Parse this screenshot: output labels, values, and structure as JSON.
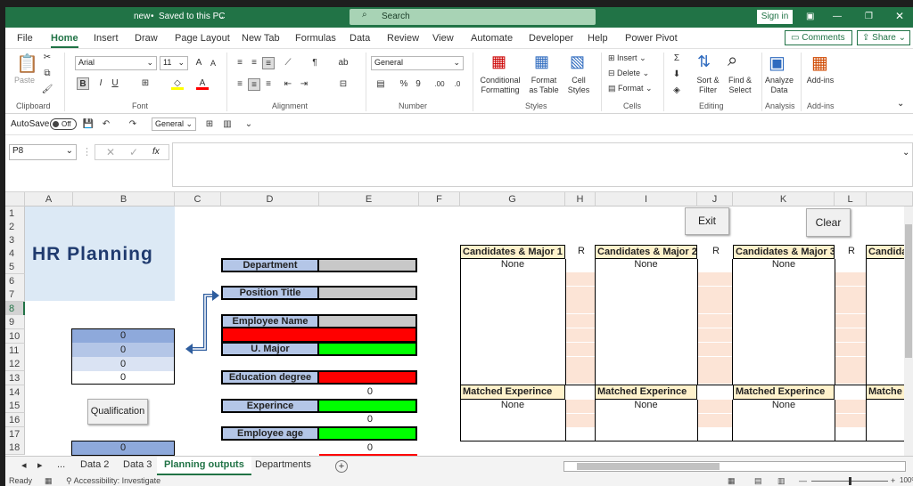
{
  "titlebar": {
    "doc": "new",
    "saved": "Saved to this PC",
    "search": "Search",
    "signin": "Sign in"
  },
  "menu": [
    "File",
    "Home",
    "Insert",
    "Draw",
    "Page Layout",
    "New Tab",
    "Formulas",
    "Data",
    "Review",
    "View",
    "Automate",
    "Developer",
    "Help",
    "Power Pivot"
  ],
  "menu_right": {
    "comments": "Comments",
    "share": "Share"
  },
  "ribbon": {
    "clipboard": "Clipboard",
    "paste": "Paste",
    "font_name": "Arial",
    "font_size": "11",
    "font": "Font",
    "alignment": "Alignment",
    "number_format": "General",
    "number": "Number",
    "conditional": "Conditional Formatting",
    "format_table": "Format as Table",
    "cell_styles": "Cell Styles",
    "styles": "Styles",
    "insert": "Insert",
    "delete": "Delete",
    "format": "Format",
    "cells": "Cells",
    "sort_filter": "Sort & Filter",
    "find_select": "Find & Select",
    "editing": "Editing",
    "analyze_data": "Analyze Data",
    "analysis": "Analysis",
    "addins": "Add-ins",
    "addins_grp": "Add-ins"
  },
  "qat": {
    "autosave": "AutoSave",
    "off": "Off",
    "style": "General"
  },
  "formula": {
    "namebox": "P8",
    "fx": "fx"
  },
  "columns": [
    "A",
    "B",
    "C",
    "D",
    "E",
    "F",
    "G",
    "H",
    "I",
    "J",
    "K",
    "L"
  ],
  "rows": [
    "1",
    "2",
    "3",
    "4",
    "5",
    "6",
    "7",
    "8",
    "9",
    "10",
    "11",
    "12",
    "13",
    "14",
    "15",
    "16",
    "17",
    "18"
  ],
  "sheet": {
    "title": "HR Planning",
    "labels": {
      "department": "Department",
      "position": "Position Title",
      "employee_name": "Employee Name",
      "u_major": "U. Major",
      "education": "Education degree",
      "experince": "Experince",
      "age": "Employee age"
    },
    "left_values": [
      "0",
      "0",
      "0",
      "0"
    ],
    "e_values": [
      "0",
      "0",
      "0"
    ],
    "b18": "0",
    "qualification": "Qualification",
    "exit": "Exit",
    "clear": "Clear",
    "cand1": "Candidates & Major 1",
    "cand2": "Candidates & Major 2",
    "cand3": "Candidates & Major 3",
    "cand4": "Candida",
    "r": "R",
    "none": "None",
    "matched": "Matched Experince",
    "matched4": "Matche"
  },
  "tabs": [
    "...",
    "Data 2",
    "Data 3",
    "Planning outputs",
    "Departments"
  ],
  "status": {
    "ready": "Ready",
    "accessibility": "Accessibility: Investigate",
    "zoom": "100%"
  },
  "colors": {
    "excel_green": "#217346",
    "label_blue": "#b4c6e7",
    "red": "#ff0000",
    "green": "#00ff00",
    "gray": "#c8c8c8",
    "peach": "#fce4d6",
    "header_yellow": "#fff2cc"
  }
}
